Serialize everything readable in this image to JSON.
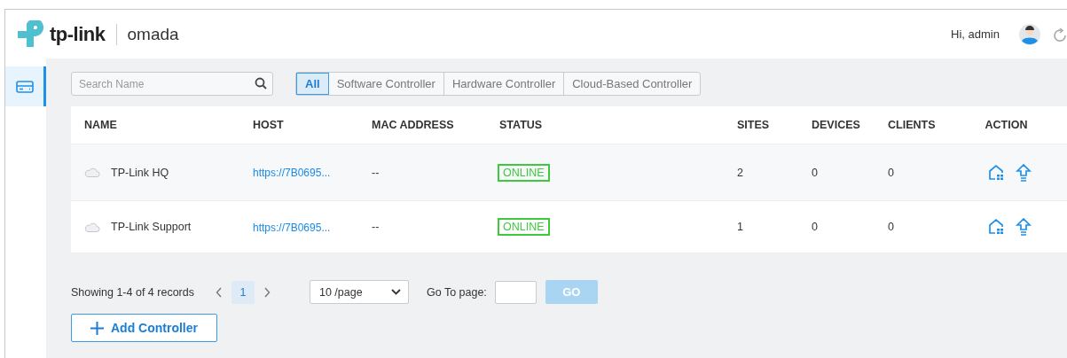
{
  "header": {
    "brand": "tp-link",
    "product": "omada",
    "greeting": "Hi, admin"
  },
  "sidebar": {
    "items": [
      {
        "selected": true
      }
    ]
  },
  "search": {
    "placeholder": "Search Name"
  },
  "filters": [
    {
      "label": "All",
      "selected": true
    },
    {
      "label": "Software Controller",
      "selected": false
    },
    {
      "label": "Hardware Controller",
      "selected": false
    },
    {
      "label": "Cloud-Based Controller",
      "selected": false
    }
  ],
  "table": {
    "columns": [
      "NAME",
      "HOST",
      "MAC ADDRESS",
      "STATUS",
      "SITES",
      "DEVICES",
      "CLIENTS",
      "ACTION"
    ],
    "rows": [
      {
        "name": "TP-Link HQ",
        "host": "https://7B0695...",
        "mac": "--",
        "status": "ONLINE",
        "sites": "2",
        "devices": "0",
        "clients": "0"
      },
      {
        "name": "TP-Link Support",
        "host": "https://7B0695...",
        "mac": "--",
        "status": "ONLINE",
        "sites": "1",
        "devices": "0",
        "clients": "0"
      }
    ]
  },
  "pagination": {
    "summary": "Showing 1-4 of 4 records",
    "pages": [
      {
        "label": "1",
        "selected": true
      }
    ],
    "page_size": "10 /page",
    "goto_label": "Go To page:",
    "go": "GO"
  },
  "add_button": "Add Controller"
}
